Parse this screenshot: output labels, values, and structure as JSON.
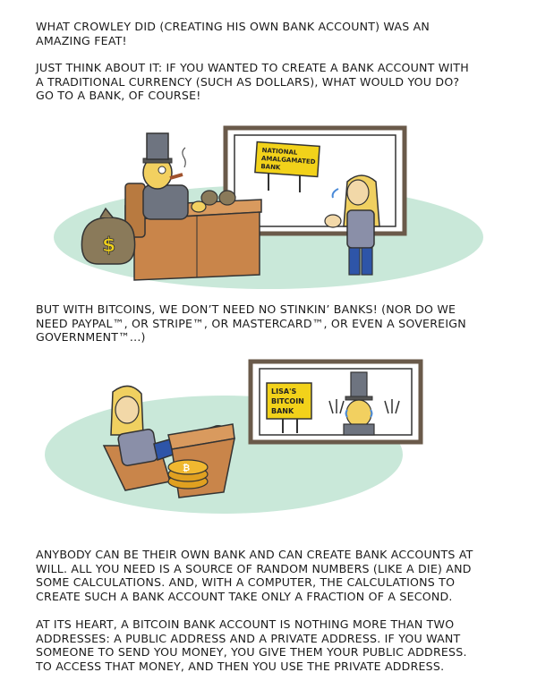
{
  "paragraphs": {
    "p1": "What Crowley did (creating his own bank account) was an\namazing feat!",
    "p2": "Just think about it: if you wanted to create a bank account with\na traditional currency (such as dollars), what would you do?\nGo to a bank, of course!",
    "p3": "But with bitcoins, we don’t need no stinkin’ banks! (Nor do we\nneed PayPal™, or Stripe™, or MasterCard™, or even a sovereign\ngovernment™...)",
    "p4": "Anybody can be their own bank and can create bank accounts at\nwill. All you need is a source of random numbers (like a die) and\nsome calculations. And, with a computer, the calculations to\ncreate such a bank account take only a fraction of a second.",
    "p5": "At its heart, a Bitcoin bank account is nothing more than two\naddresses: a public address and a private address. If you want\nsomeone to send you money, you give them your public address.\nTo access that money, and then you use the private address."
  },
  "panel1": {
    "sign_lines": [
      "NATIONAL",
      "AMALGAMATED",
      "BANK"
    ],
    "moneybag_symbol": "$"
  },
  "panel2": {
    "sign_lines": [
      "LISA'S",
      "BITCOIN",
      "BANK"
    ],
    "coin_symbol": "₿"
  },
  "colors": {
    "floor": "#c9e8d9",
    "desk": "#c9854a",
    "window_frame": "#6a5a4a",
    "sign": "#f2d21a",
    "hair": "#f0d060",
    "jeans": "#2e55a8",
    "suit": "#6e7480",
    "sweater": "#8a8fa8",
    "coin": "#e0a020"
  }
}
